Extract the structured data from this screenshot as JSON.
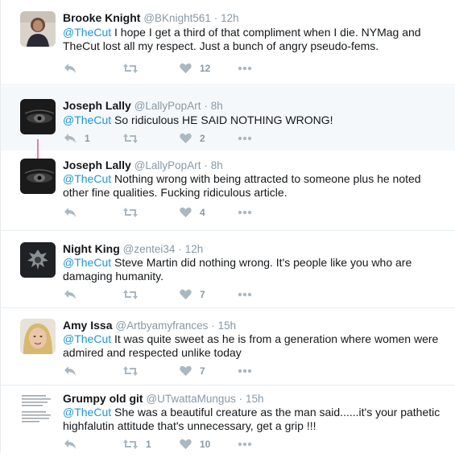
{
  "mention": "@TheCut",
  "dot": "·",
  "colors": {
    "link": "#1b95e0",
    "muted": "#8899a6",
    "conversation_bg": "#f5f8fa",
    "thread_line": "#e0246b"
  },
  "icons": {
    "reply": "reply-icon",
    "retweet": "retweet-icon",
    "like": "heart-icon",
    "more": "more-dots-icon"
  },
  "tweets": [
    {
      "name": "Brooke Knight",
      "handle": "@BKnight561",
      "time": "12h",
      "text": "I hope I get a third of that compliment when I die. NYMag and TheCut lost all my respect. Just a bunch of angry pseudo-fems.",
      "reply_count": "",
      "retweet_count": "",
      "like_count": "12"
    },
    {
      "name": "Joseph Lally",
      "handle": "@LallyPopArt",
      "time": "8h",
      "text": "So ridiculous HE SAID NOTHING WRONG!",
      "reply_count": "1",
      "retweet_count": "",
      "like_count": "2"
    },
    {
      "name": "Joseph Lally",
      "handle": "@LallyPopArt",
      "time": "8h",
      "text": "Nothing wrong with being attracted to someone plus he noted other fine qualities. Fucking ridiculous article.",
      "reply_count": "",
      "retweet_count": "",
      "like_count": "4"
    },
    {
      "name": "Night King",
      "handle": "@zentei34",
      "time": "12h",
      "text": "Steve Martin did nothing wrong. It's people like you who are damaging humanity.",
      "reply_count": "",
      "retweet_count": "",
      "like_count": "7"
    },
    {
      "name": "Amy Issa",
      "handle": "@Artbyamyfrances",
      "time": "15h",
      "text": "It was quite sweet as he is from a generation where women were admired and respected unlike today",
      "reply_count": "",
      "retweet_count": "",
      "like_count": "7"
    },
    {
      "name": "Grumpy old git",
      "handle": "@UTwattaMungus",
      "time": "15h",
      "text": "She was a beautiful creature as the man said......it's your pathetic highfalutin attitude that's unnecessary, get a grip !!!",
      "reply_count": "",
      "retweet_count": "1",
      "like_count": "10"
    }
  ]
}
